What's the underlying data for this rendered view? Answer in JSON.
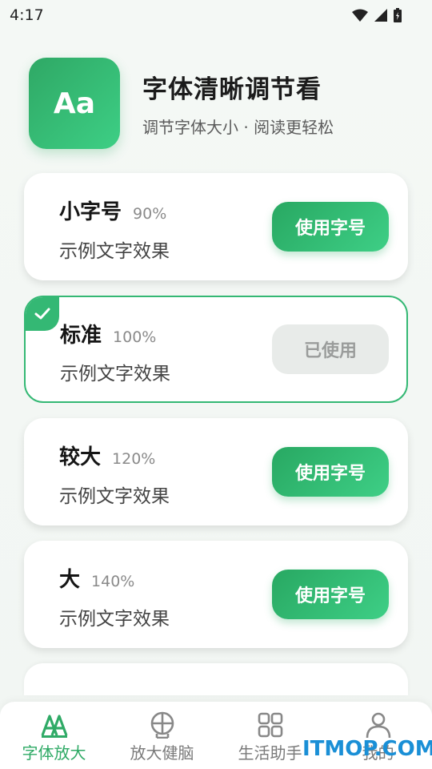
{
  "status": {
    "time": "4:17"
  },
  "header": {
    "logo_text": "Aa",
    "title": "字体清晰调节看",
    "subtitle": "调节字体大小 · 阅读更轻松"
  },
  "sizes": [
    {
      "name": "小字号",
      "percent": "90%",
      "sample": "示例文字效果",
      "button": "使用字号",
      "selected": false
    },
    {
      "name": "标准",
      "percent": "100%",
      "sample": "示例文字效果",
      "button": "已使用",
      "selected": true
    },
    {
      "name": "较大",
      "percent": "120%",
      "sample": "示例文字效果",
      "button": "使用字号",
      "selected": false
    },
    {
      "name": "大",
      "percent": "140%",
      "sample": "示例文字效果",
      "button": "使用字号",
      "selected": false
    }
  ],
  "nav": [
    {
      "label": "字体放大",
      "icon": "font-size-icon",
      "active": true
    },
    {
      "label": "放大健脑",
      "icon": "brain-icon",
      "active": false
    },
    {
      "label": "生活助手",
      "icon": "grid-icon",
      "active": false
    },
    {
      "label": "我的",
      "icon": "person-icon",
      "active": false
    }
  ],
  "watermark": "ITMOP.COM",
  "colors": {
    "accent": "#2faa66",
    "accent_light": "#3ecf86",
    "used_bg": "#e8ebe9"
  }
}
